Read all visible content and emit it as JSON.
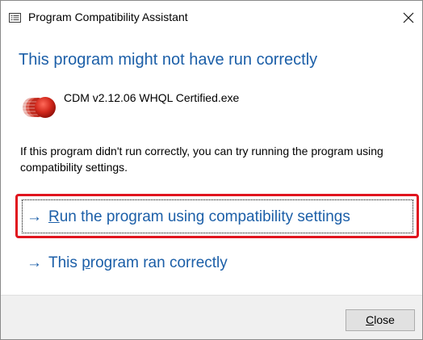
{
  "window": {
    "title": "Program Compatibility Assistant"
  },
  "dialog": {
    "heading": "This program might not have run correctly",
    "program_name": "CDM v2.12.06 WHQL Certified.exe",
    "description": "If this program didn't run correctly, you can try running the program using compatibility settings."
  },
  "options": [
    {
      "arrow": "→",
      "access_key": "R",
      "label_before": "",
      "label_after": "un the program using compatibility settings",
      "selected": true
    },
    {
      "arrow": "→",
      "access_key": "p",
      "label_before": "This ",
      "label_after": "rogram ran correctly",
      "selected": false
    }
  ],
  "footer": {
    "close_access_key": "C",
    "close_label_rest": "lose"
  },
  "colors": {
    "heading": "#1c5fa8",
    "link": "#1c5fa8",
    "highlight": "#e0141e",
    "footer_bg": "#f0f0f0"
  },
  "icons": {
    "app": "window-list-icon",
    "close": "close-icon",
    "program": "crystaldiskmark-icon",
    "arrow": "right-arrow-icon"
  }
}
